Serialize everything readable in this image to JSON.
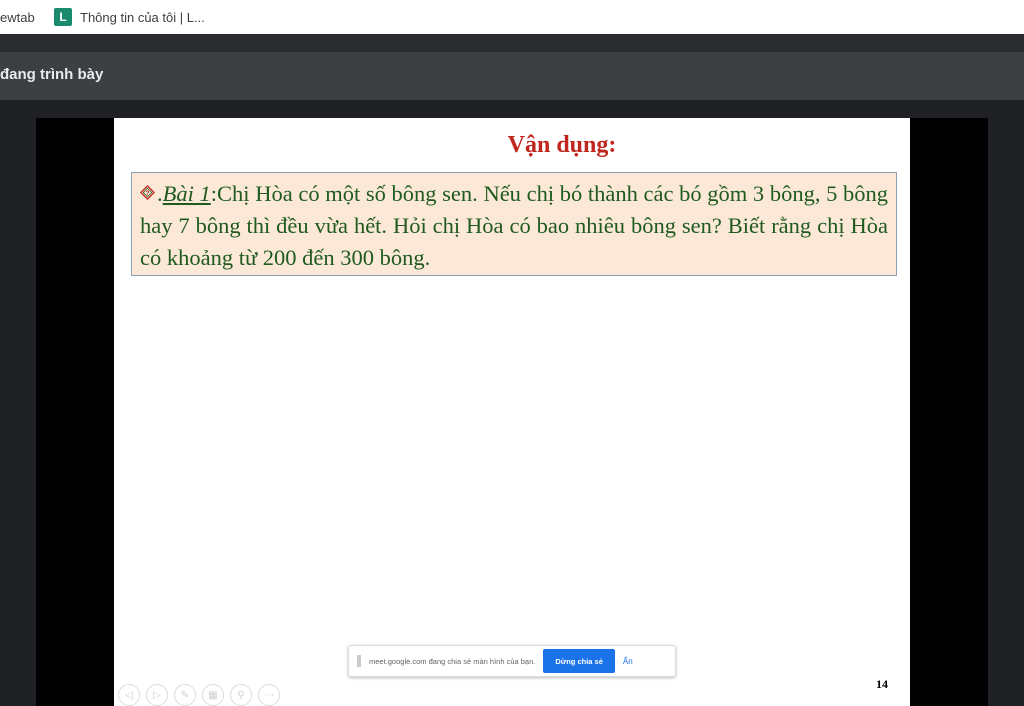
{
  "bookmarks": {
    "items": [
      {
        "label": "ewtab"
      },
      {
        "favicon": "L",
        "label": "Thông tin của tôi | L..."
      }
    ],
    "colors": {
      "favicon_bg": "#1a8a6e"
    }
  },
  "presenting": {
    "label": "đang trình bày"
  },
  "slide": {
    "title": "Vận dụng:",
    "problem": {
      "icon": "diamond-question-icon",
      "prefix": ".",
      "label": "Bài 1",
      "text": ":Chị Hòa có một số bông sen. Nếu chị bó thành các bó gồm 3 bông, 5 bông hay 7 bông thì đều vừa hết. Hỏi chị Hòa có bao nhiêu bông sen? Biết rằng chị Hòa có khoảng từ 200 đến 300 bông."
    },
    "page_number": "14",
    "colors": {
      "title": "#c0251e",
      "text": "#1f5a1f",
      "box_bg": "#fbe8d7"
    }
  },
  "share_notice": {
    "text": "meet.google.com đang chia sẻ màn hình của bạn.",
    "stop_label": "Dừng chia sẻ",
    "hide_label": "Ẩn"
  }
}
